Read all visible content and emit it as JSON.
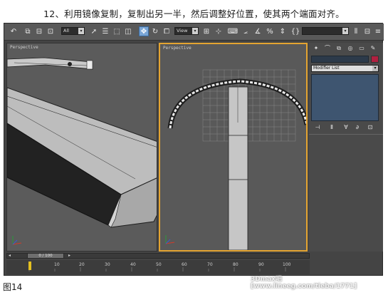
{
  "caption_top": "12、利用镜像复制，复制出另一半，然后调整好位置，使其两个端面对齐。",
  "caption_bottom": "图14",
  "watermark": "3Dmax吧 [www.lineeg.com/tieba/1771]",
  "toolbar": {
    "selection_filter": "All",
    "reference_coordinate": "View"
  },
  "viewports": {
    "left_label": "Perspective",
    "right_label": "Perspective"
  },
  "command_panel": {
    "modifier_list": "Modifier List",
    "swatch_color": "#b02040"
  },
  "timeline": {
    "frame_indicator": "0 / 100",
    "ticks": [
      "10",
      "20",
      "30",
      "40",
      "50",
      "60",
      "70",
      "80",
      "90",
      "100"
    ]
  },
  "colors": {
    "active_viewport_border": "#e4a431",
    "key_marker": "#e4c020"
  }
}
